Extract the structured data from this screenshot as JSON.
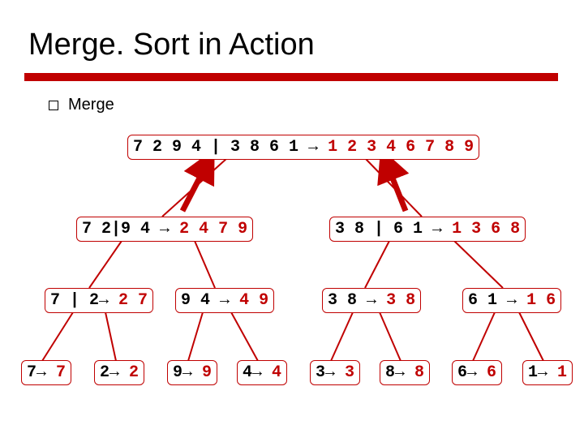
{
  "slide": {
    "title": "Merge. Sort in Action",
    "bullet": "Merge"
  },
  "nodes": {
    "root": {
      "input": "7 2 9 4 | 3 8 6 1",
      "result": "1 2 3 4 6 7 8 9"
    },
    "l1l": {
      "input": "7 2|9 4",
      "result": "2 4 7 9"
    },
    "l1r": {
      "input": "3 8 | 6 1",
      "result": "1 3 6 8"
    },
    "l2a": {
      "input": "7 | 2",
      "result": "2 7"
    },
    "l2b": {
      "input": "9 4",
      "result": "4 9"
    },
    "l2c": {
      "input": "3 8",
      "result": "3 8"
    },
    "l2d": {
      "input": "6 1",
      "result": "1 6"
    },
    "l3a": {
      "input": "7",
      "result": "7"
    },
    "l3b": {
      "input": "2",
      "result": "2"
    },
    "l3c": {
      "input": "9",
      "result": "9"
    },
    "l3d": {
      "input": "4",
      "result": "4"
    },
    "l3e": {
      "input": "3",
      "result": "3"
    },
    "l3f": {
      "input": "8",
      "result": "8"
    },
    "l3g": {
      "input": "6",
      "result": "6"
    },
    "l3h": {
      "input": "1",
      "result": "1"
    }
  },
  "arrow": "→"
}
